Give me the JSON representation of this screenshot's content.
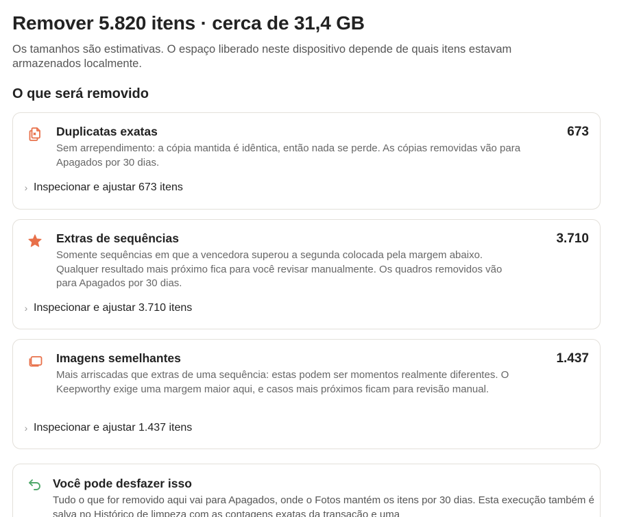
{
  "header": {
    "title": "Remover 5.820 itens · cerca de 31,4 GB",
    "subtitle": "Os tamanhos são estimativas. O espaço liberado neste dispositivo depende de quais itens estavam armazenados localmente."
  },
  "section": {
    "heading": "O que será removido"
  },
  "categories": [
    {
      "icon": "duplicate-files-icon",
      "title": "Duplicatas exatas",
      "count": "673",
      "description": "Sem arrependimento: a cópia mantida é idêntica, então nada se perde. As cópias removidas vão para Apagados por 30 dias.",
      "inspect_label": "Inspecionar e ajustar 673 itens"
    },
    {
      "icon": "star-icon",
      "title": "Extras de sequências",
      "count": "3.710",
      "description": "Somente sequências em que a vencedora superou a segunda colocada pela margem abaixo. Qualquer resultado mais próximo fica para você revisar manualmente. Os quadros removidos vão para Apagados por 30 dias.",
      "inspect_label": "Inspecionar e ajustar 3.710 itens"
    },
    {
      "icon": "stacked-photos-icon",
      "title": "Imagens semelhantes",
      "count": "1.437",
      "description": "Mais arriscadas que extras de uma sequência: estas podem ser momentos realmente diferentes. O Keepworthy exige uma margem maior aqui, e casos mais próximos ficam para revisão manual.",
      "inspect_label": "Inspecionar e ajustar 1.437 itens"
    }
  ],
  "undo": {
    "icon": "undo-arrow-icon",
    "title": "Você pode desfazer isso",
    "description": "Tudo o que for removido aqui vai para Apagados, onde o Fotos mantém os itens por 30 dias. Esta execução também é salva no Histórico de limpeza com as contagens exatas da transação e uma"
  },
  "colors": {
    "accent": "#e8704a",
    "undo_accent": "#4fa86a",
    "card_border": "#e3e0da"
  },
  "chevron_icon": "chevron-right-icon"
}
